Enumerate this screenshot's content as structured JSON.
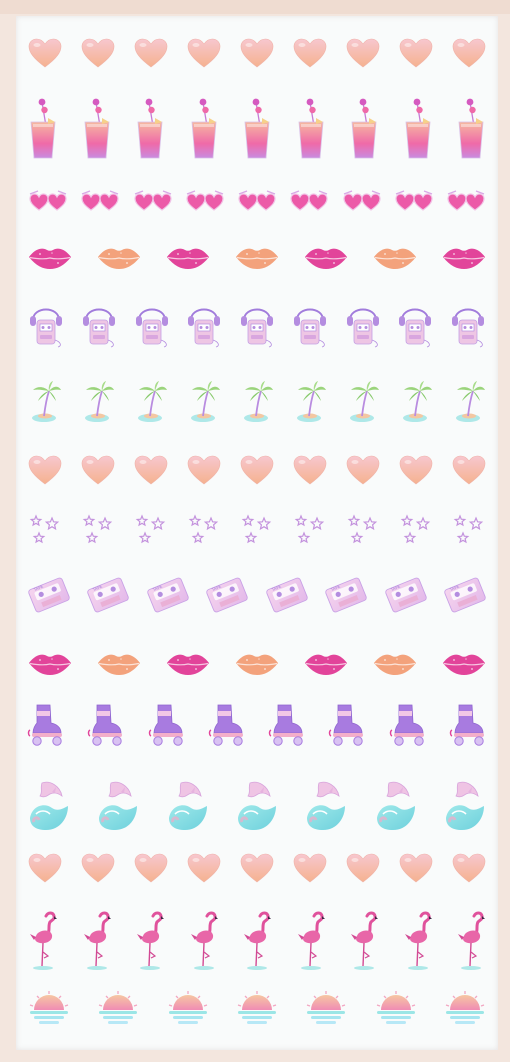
{
  "sheet": {
    "background": "#f9fbfb",
    "frame_color": "#f3e6de",
    "rows": [
      {
        "motif": "heart-icon",
        "count": 9
      },
      {
        "motif": "cocktail-glass-icon",
        "count": 9
      },
      {
        "motif": "heart-sunglasses-icon",
        "count": 9
      },
      {
        "motif": "glitter-lips-icon",
        "count": 7,
        "colors": [
          "#e2449a",
          "#f3a27c"
        ]
      },
      {
        "motif": "cassette-player-headphones-icon",
        "count": 9
      },
      {
        "motif": "palm-tree-island-icon",
        "count": 9
      },
      {
        "motif": "heart-icon",
        "count": 9
      },
      {
        "motif": "star-cluster-icon",
        "count": 9
      },
      {
        "motif": "cassette-tape-icon",
        "count": 8
      },
      {
        "motif": "glitter-lips-icon",
        "count": 7,
        "colors": [
          "#e2449a",
          "#f3a27c"
        ]
      },
      {
        "motif": "roller-skate-icon",
        "count": 8
      },
      {
        "motif": "dolphin-wave-icon",
        "count": 7
      },
      {
        "motif": "heart-icon",
        "count": 9
      },
      {
        "motif": "flamingo-icon",
        "count": 9
      },
      {
        "motif": "sunset-icon",
        "count": 7
      }
    ],
    "palette": {
      "heart_top": "#f7c7cf",
      "heart_bottom": "#f5b28f",
      "pink": "#e2449a",
      "peach": "#f3a27c",
      "lavender": "#b48de0",
      "aqua": "#8fe0df",
      "green": "#9bd47c"
    }
  }
}
